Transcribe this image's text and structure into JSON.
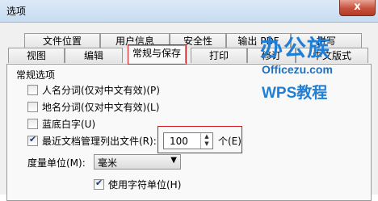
{
  "window": {
    "title": "选项",
    "close_label": "x"
  },
  "tabs_row1": [
    "文件位置",
    "用户信息",
    "安全性",
    "输出 PDF",
    "拼写"
  ],
  "tabs_row2": [
    "视图",
    "编辑",
    "常规与保存",
    "打印",
    "修订",
    "中文版式"
  ],
  "group": {
    "title": "常规选项"
  },
  "options": [
    {
      "label": "人名分词(仅对中文有效)(P)",
      "checked": false
    },
    {
      "label": "地名分词(仅对中文有效)(L)",
      "checked": false
    },
    {
      "label": "蓝底白字(U)",
      "checked": false
    },
    {
      "label": "最近文档管理列出文件(R):",
      "checked": true
    }
  ],
  "recent": {
    "value": "100",
    "unit": "个(E)"
  },
  "measure": {
    "label": "度量单位(M):",
    "value": "毫米"
  },
  "char_unit": {
    "label": "使用字符单位(H)",
    "checked": true
  },
  "watermark": {
    "cn": "办公族",
    "url": "Officezu.com",
    "wps": "WPS教程"
  },
  "colors": {
    "accent": "#d4171f",
    "logo": "#1f7fd6"
  }
}
